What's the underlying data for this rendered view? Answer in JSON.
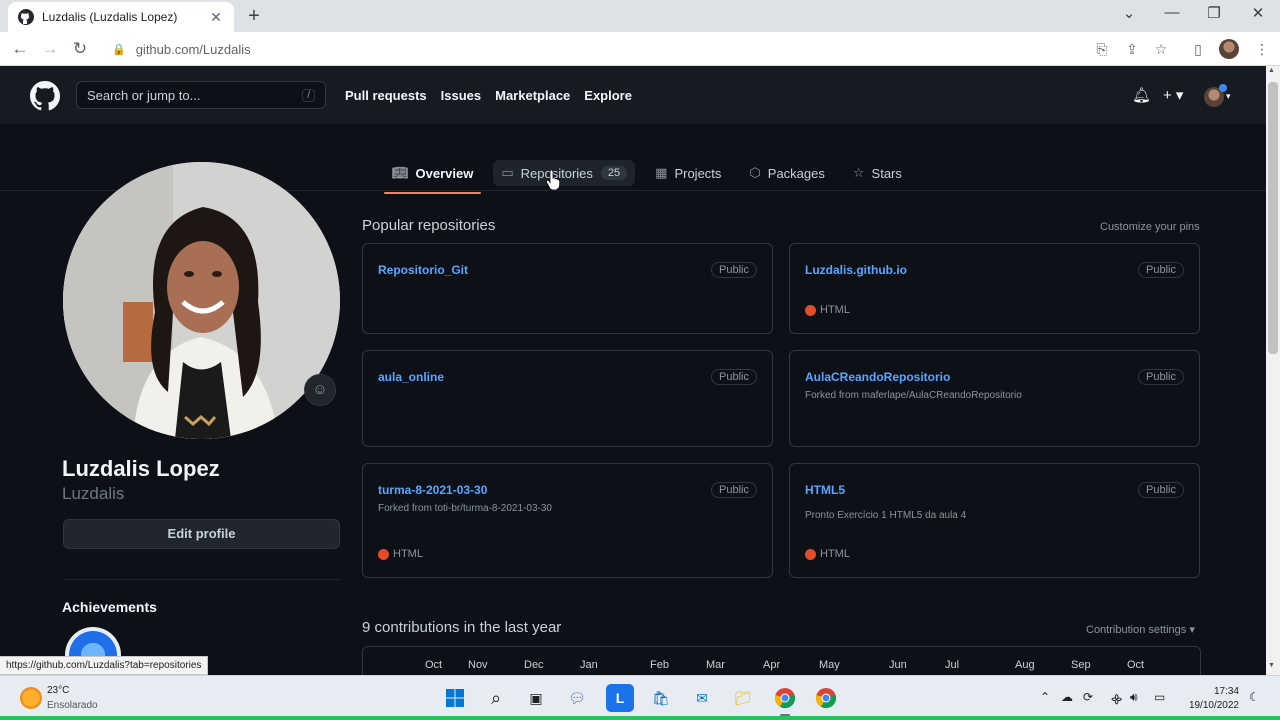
{
  "browser": {
    "tab_title": "Luzdalis (Luzdalis Lopez)",
    "url": "github.com/Luzdalis",
    "status_url": "https://github.com/Luzdalis?tab=repositories"
  },
  "github": {
    "search_placeholder": "Search or jump to...",
    "search_shortcut": "/",
    "nav": [
      "Pull requests",
      "Issues",
      "Marketplace",
      "Explore"
    ],
    "tabs": {
      "overview": "Overview",
      "repositories": "Repositories",
      "repositories_count": "25",
      "projects": "Projects",
      "packages": "Packages",
      "stars": "Stars"
    },
    "profile": {
      "fullname": "Luzdalis Lopez",
      "login": "Luzdalis",
      "edit_label": "Edit profile",
      "achievements_title": "Achievements"
    },
    "popular": {
      "title": "Popular repositories",
      "customize": "Customize your pins",
      "visibility": "Public",
      "repos": [
        {
          "name": "Repositorio_Git",
          "forked": "",
          "desc": "",
          "lang": ""
        },
        {
          "name": "Luzdalis.github.io",
          "forked": "",
          "desc": "",
          "lang": "HTML"
        },
        {
          "name": "aula_online",
          "forked": "",
          "desc": "",
          "lang": ""
        },
        {
          "name": "AulaCReandoRepositorio",
          "forked": "Forked from maferlape/AulaCReandoRepositorio",
          "desc": "",
          "lang": ""
        },
        {
          "name": "turma-8-2021-03-30",
          "forked": "Forked from toti-br/turma-8-2021-03-30",
          "desc": "",
          "lang": "HTML"
        },
        {
          "name": "HTML5",
          "forked": "",
          "desc": "Pronto Exercício 1 HTML5 da aula 4",
          "lang": "HTML"
        }
      ]
    },
    "contributions": {
      "title": "9 contributions in the last year",
      "settings": "Contribution settings ▾",
      "months": [
        "Oct",
        "Nov",
        "Dec",
        "Jan",
        "Feb",
        "Mar",
        "Apr",
        "May",
        "Jun",
        "Jul",
        "Aug",
        "Sep",
        "Oct"
      ]
    }
  },
  "taskbar": {
    "temp": "23°C",
    "condition": "Ensolarado",
    "time": "17:34",
    "date": "19/10/2022"
  },
  "colors": {
    "accent_tab": "#f78166",
    "link": "#58a6ff",
    "html_lang": "#e34c26"
  }
}
